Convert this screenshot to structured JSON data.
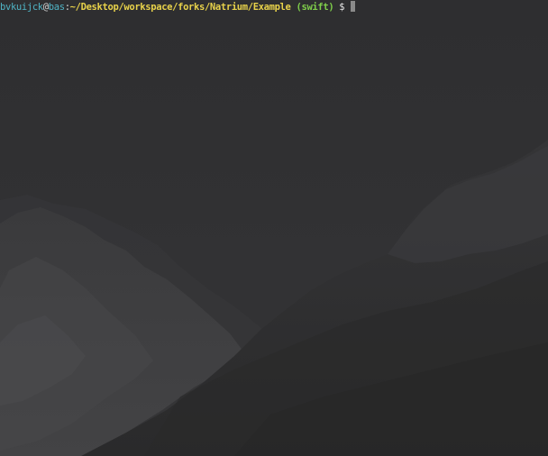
{
  "terminal": {
    "prompt": {
      "user": "bvkuijck",
      "at": "@",
      "host": "bas",
      "colon": ":",
      "path": "~/Desktop/workspace/forks/Natrium/Example",
      "branch": "(swift)",
      "symbol": "$"
    },
    "input": ""
  },
  "colors": {
    "background": "#2d2d2f",
    "user": "#4fb3c4",
    "path": "#e8d24a",
    "branch": "#7fce4a",
    "cursor": "#8a8a8a"
  }
}
